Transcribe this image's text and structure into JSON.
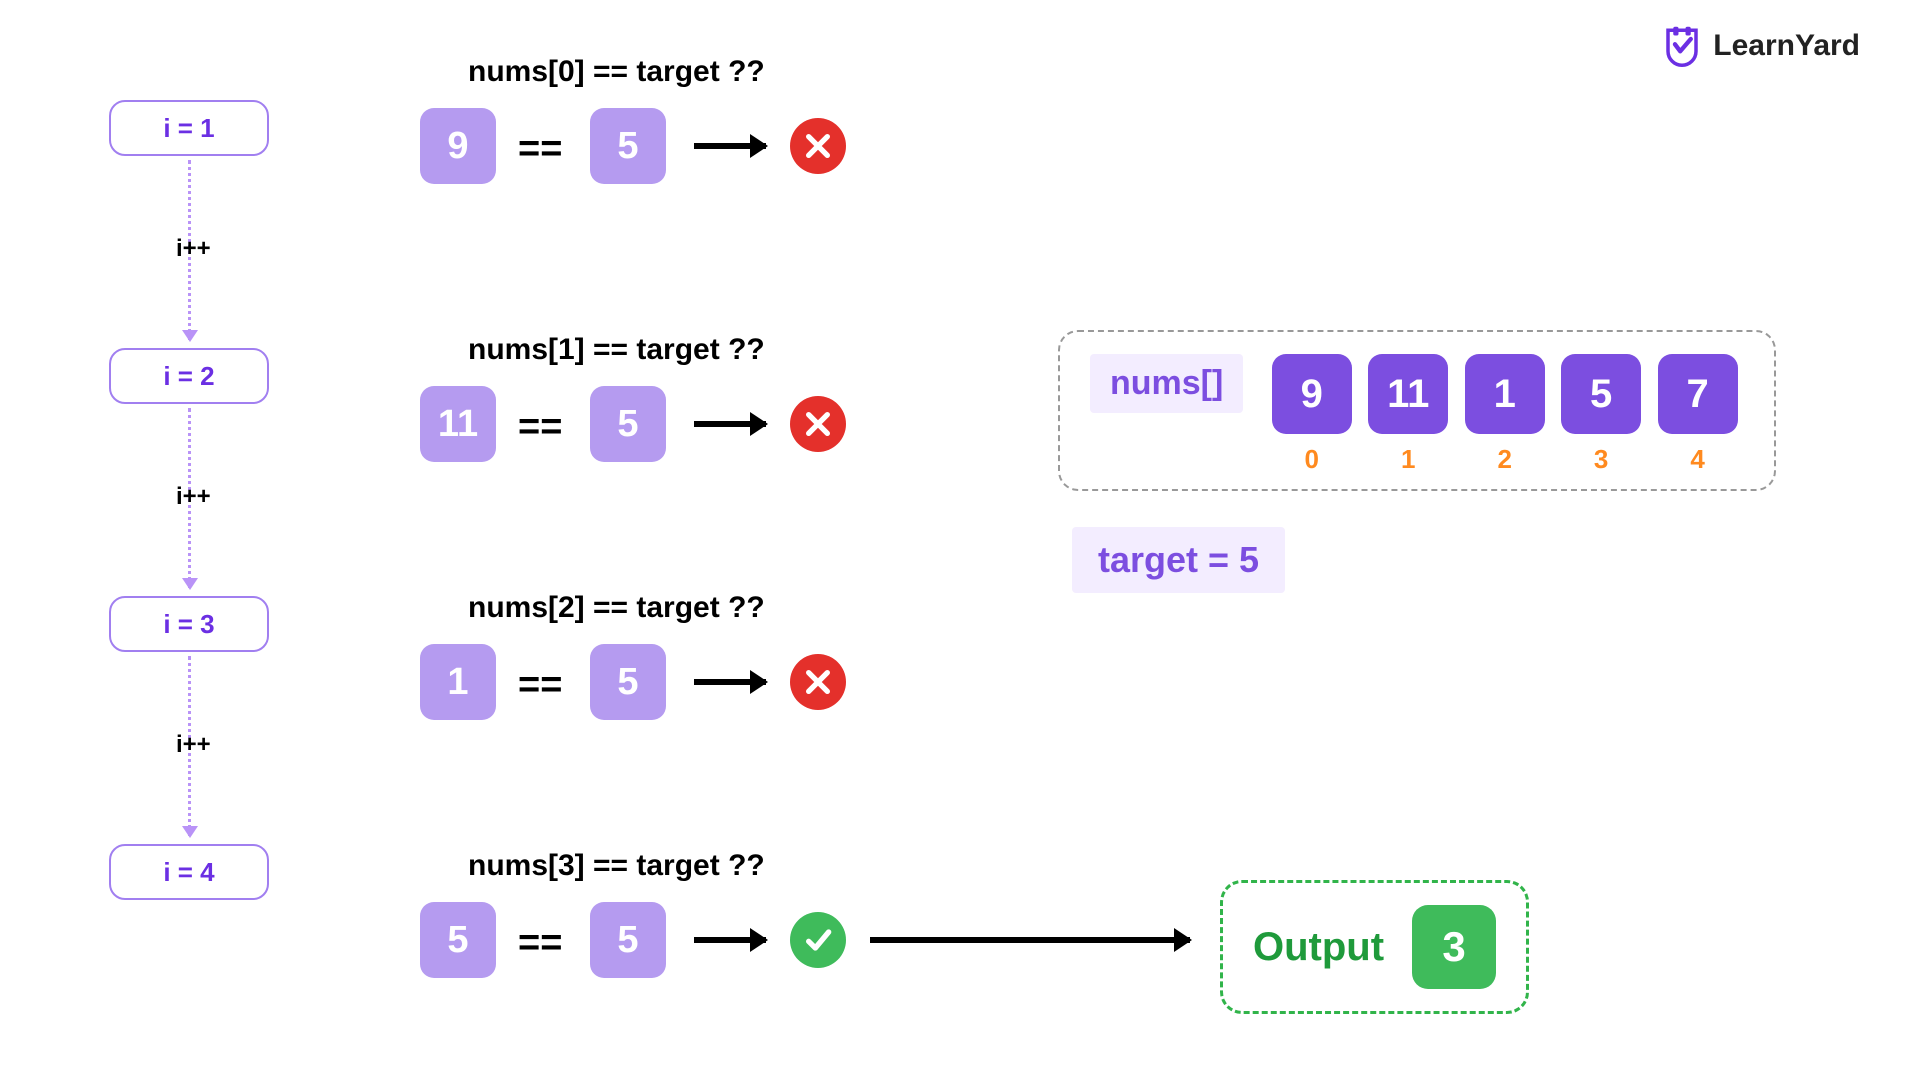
{
  "brand": {
    "name": "LearnYard"
  },
  "iterations": {
    "i1": "i = 1",
    "i2": "i = 2",
    "i3": "i = 3",
    "i4": "i = 4",
    "inc": "i++"
  },
  "comparisons": [
    {
      "title": "nums[0] == target ??",
      "left": "9",
      "op": "==",
      "right": "5",
      "pass": false
    },
    {
      "title": "nums[1] == target ??",
      "left": "11",
      "op": "==",
      "right": "5",
      "pass": false
    },
    {
      "title": "nums[2] == target ??",
      "left": "1",
      "op": "==",
      "right": "5",
      "pass": false
    },
    {
      "title": "nums[3] == target ??",
      "left": "5",
      "op": "==",
      "right": "5",
      "pass": true
    }
  ],
  "array": {
    "label": "nums[]",
    "values": [
      "9",
      "11",
      "1",
      "5",
      "7"
    ],
    "indices": [
      "0",
      "1",
      "2",
      "3",
      "4"
    ]
  },
  "target_label": "target = 5",
  "output": {
    "label": "Output",
    "value": "3"
  }
}
